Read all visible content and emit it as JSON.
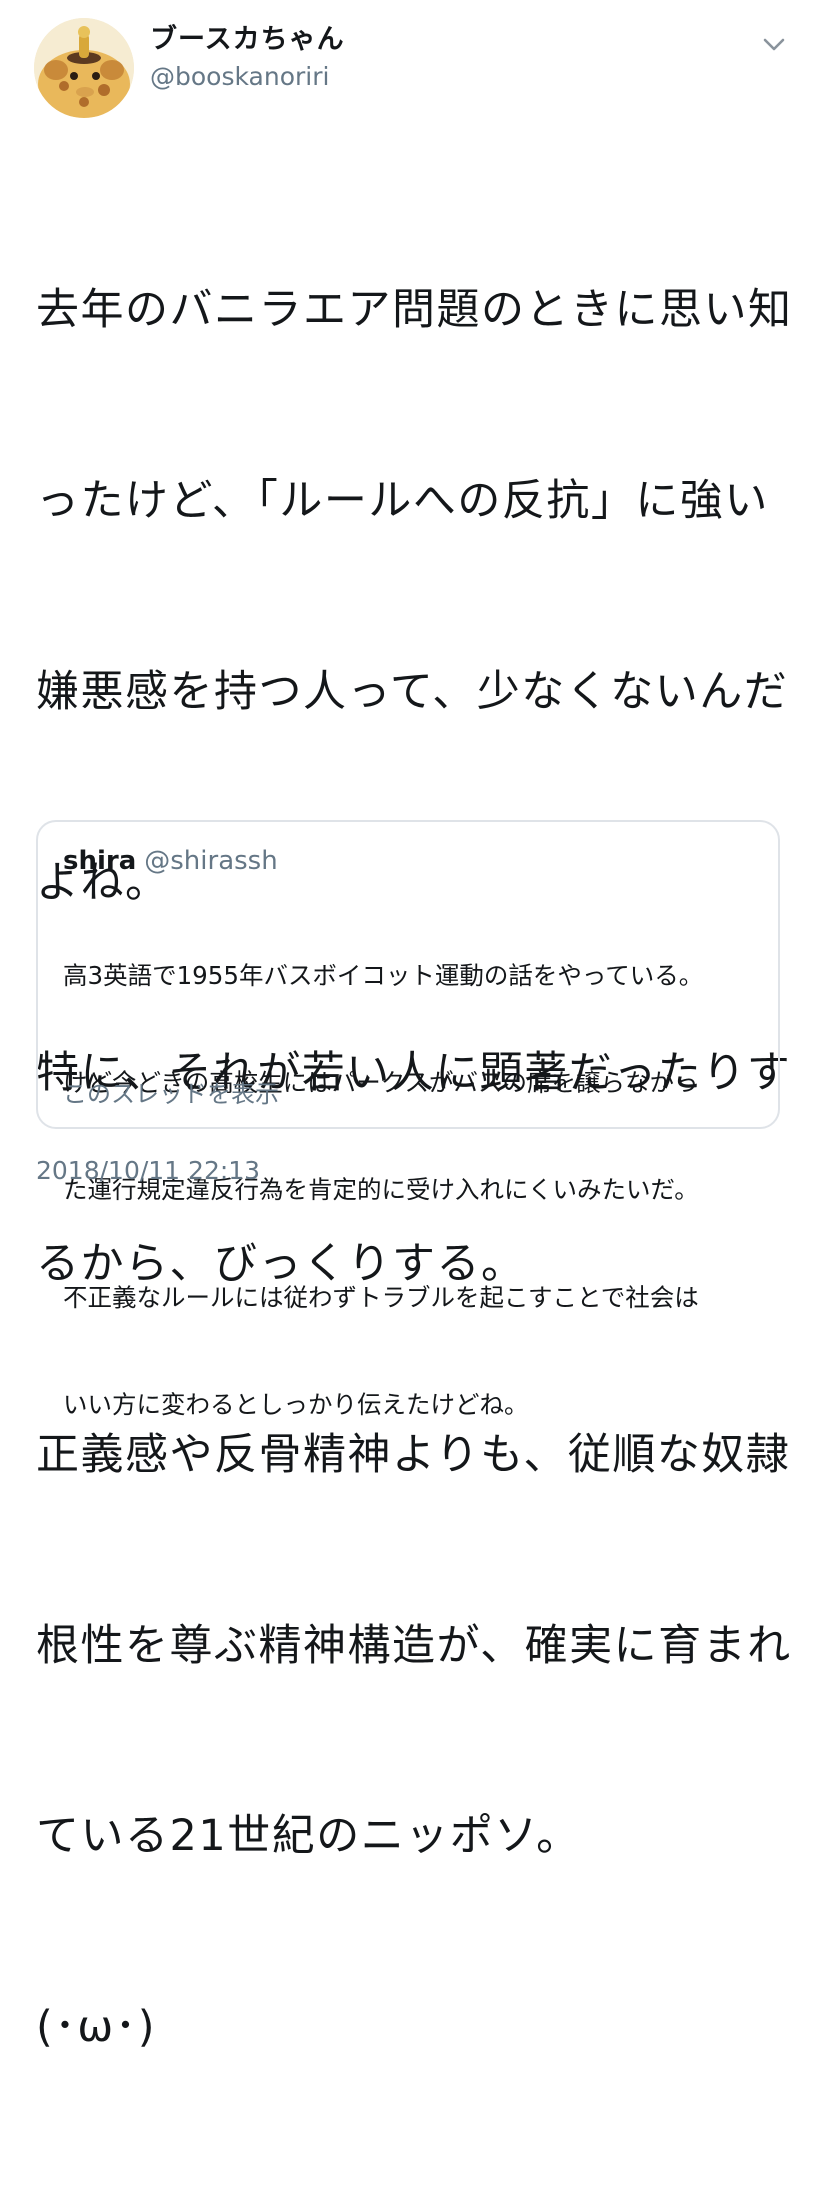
{
  "tweet": {
    "author": {
      "display_name": "ブースカちゃん",
      "handle": "@booskanoriri"
    },
    "body_lines": [
      "去年のバニラエア問題のときに思い知",
      "ったけど、「ルールへの反抗」に強い",
      "嫌悪感を持つ人って、少なくないんだ",
      "よね。",
      "特に、それが若い人に顕著だったりす",
      "るから、びっくりする。",
      "正義感や反骨精神よりも、従順な奴隷",
      "根性を尊ぶ精神構造が、確実に育まれ",
      "ている21世紀のニッポソ。",
      "(･ω･)"
    ],
    "quoted": {
      "name": "shira",
      "handle": "@shirassh",
      "lines": [
        "高3英語で1955年バスボイコット運動の話をやっている。",
        "けど今どきの高校生にはパークスがバスの席を譲らなかっ",
        "た運行規定違反行為を肯定的に受け入れにくいみたいだ。",
        "不正義なルールには従わずトラブルを起こすことで社会は",
        "いい方に変わるとしっかり伝えたけどね。"
      ],
      "show_thread": "このスレッドを表示"
    },
    "timestamp": "2018/10/11 22:13",
    "icons": {
      "menu": "chevron-down-icon",
      "avatar": "giraffe-avatar"
    }
  }
}
